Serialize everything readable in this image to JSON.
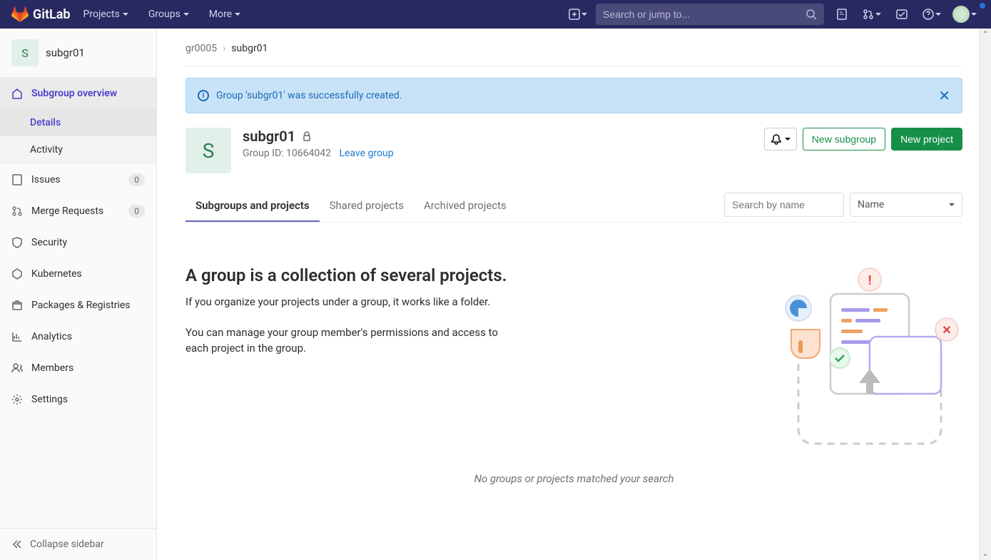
{
  "navbar": {
    "brand": "GitLab",
    "items": [
      "Projects",
      "Groups",
      "More"
    ],
    "search_placeholder": "Search or jump to..."
  },
  "sidebar": {
    "avatar_letter": "S",
    "group_name": "subgr01",
    "overview_label": "Subgroup overview",
    "sub": {
      "details": "Details",
      "activity": "Activity"
    },
    "items": [
      {
        "label": "Issues",
        "badge": "0"
      },
      {
        "label": "Merge Requests",
        "badge": "0"
      },
      {
        "label": "Security"
      },
      {
        "label": "Kubernetes"
      },
      {
        "label": "Packages & Registries"
      },
      {
        "label": "Analytics"
      },
      {
        "label": "Members"
      },
      {
        "label": "Settings"
      }
    ],
    "collapse": "Collapse sidebar"
  },
  "breadcrumb": {
    "parent": "gr0005",
    "current": "subgr01"
  },
  "alert": {
    "text": "Group 'subgr01' was successfully created."
  },
  "group": {
    "avatar_letter": "S",
    "name": "subgr01",
    "id_label": "Group ID: 10664042",
    "leave": "Leave group",
    "new_subgroup": "New subgroup",
    "new_project": "New project"
  },
  "tabs": {
    "items": [
      "Subgroups and projects",
      "Shared projects",
      "Archived projects"
    ],
    "search_placeholder": "Search by name",
    "sort": "Name"
  },
  "empty": {
    "heading": "A group is a collection of several projects.",
    "p1": "If you organize your projects under a group, it works like a folder.",
    "p2": "You can manage your group member's permissions and access to each project in the group.",
    "no_match": "No groups or projects matched your search"
  }
}
